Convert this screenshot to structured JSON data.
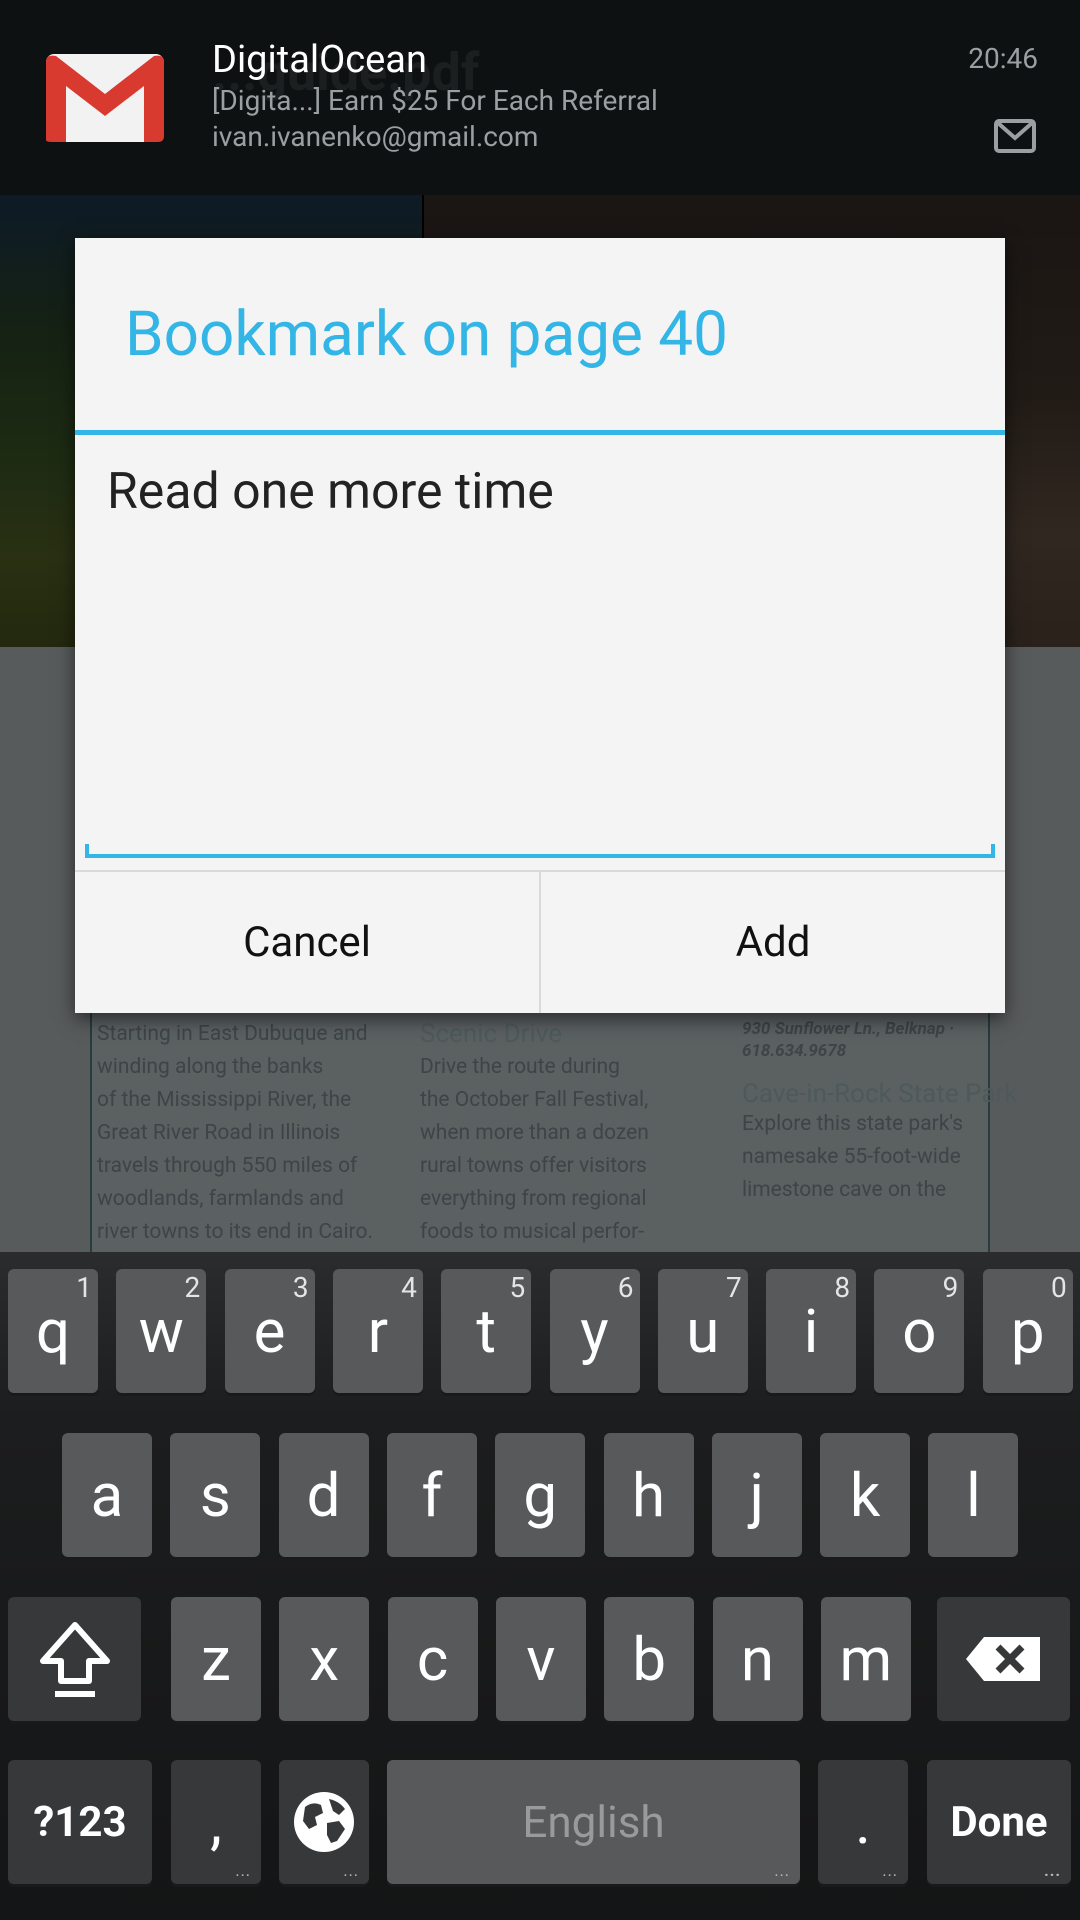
{
  "notification": {
    "sender": "DigitalOcean",
    "subject": "[Digita...] Earn $25 For Each Referral",
    "account": "ivan.ivanenko@gmail.com",
    "time": "20:46",
    "app_icon": "gmail-icon",
    "small_icon": "gmail-small-icon"
  },
  "background": {
    "faded_title": "...guide.pdf",
    "col1": [
      "Starting in East Dubuque and",
      "winding along the banks",
      "of the Mississippi River, the",
      "Great River Road in Illinois",
      "travels through 550 miles of",
      "woodlands, farmlands and",
      "river towns to its end in Cairo."
    ],
    "col2_heading": "Scenic Drive",
    "col2": [
      "Drive the route during",
      "the October Fall Festival,",
      "when more than a dozen",
      "rural towns offer visitors",
      "everything from regional",
      "foods to musical perfor-"
    ],
    "col3_top": "930 Sunflower Ln., Belknap ·",
    "col3_phone": "618.634.9678",
    "col3_heading": "Cave-in-Rock State Park",
    "col3": [
      "Explore this state park's",
      "namesake 55-foot-wide",
      "limestone cave on the"
    ]
  },
  "dialog": {
    "title": "Bookmark on page 40",
    "note_value": "Read one more time",
    "cancel_label": "Cancel",
    "add_label": "Add"
  },
  "keyboard": {
    "row1": [
      {
        "label": "q",
        "hint": "1"
      },
      {
        "label": "w",
        "hint": "2"
      },
      {
        "label": "e",
        "hint": "3"
      },
      {
        "label": "r",
        "hint": "4"
      },
      {
        "label": "t",
        "hint": "5"
      },
      {
        "label": "y",
        "hint": "6"
      },
      {
        "label": "u",
        "hint": "7"
      },
      {
        "label": "i",
        "hint": "8"
      },
      {
        "label": "o",
        "hint": "9"
      },
      {
        "label": "p",
        "hint": "0"
      }
    ],
    "row2": [
      "a",
      "s",
      "d",
      "f",
      "g",
      "h",
      "j",
      "k",
      "l"
    ],
    "row3": [
      "z",
      "x",
      "c",
      "v",
      "b",
      "n",
      "m"
    ],
    "symbols_label": "?123",
    "comma_label": ",",
    "space_label": "English",
    "period_label": ".",
    "done_label": "Done"
  },
  "colors": {
    "accent": "#33b5e5",
    "dialog_bg": "#f4f4f4",
    "key_bg": "#58595a"
  }
}
